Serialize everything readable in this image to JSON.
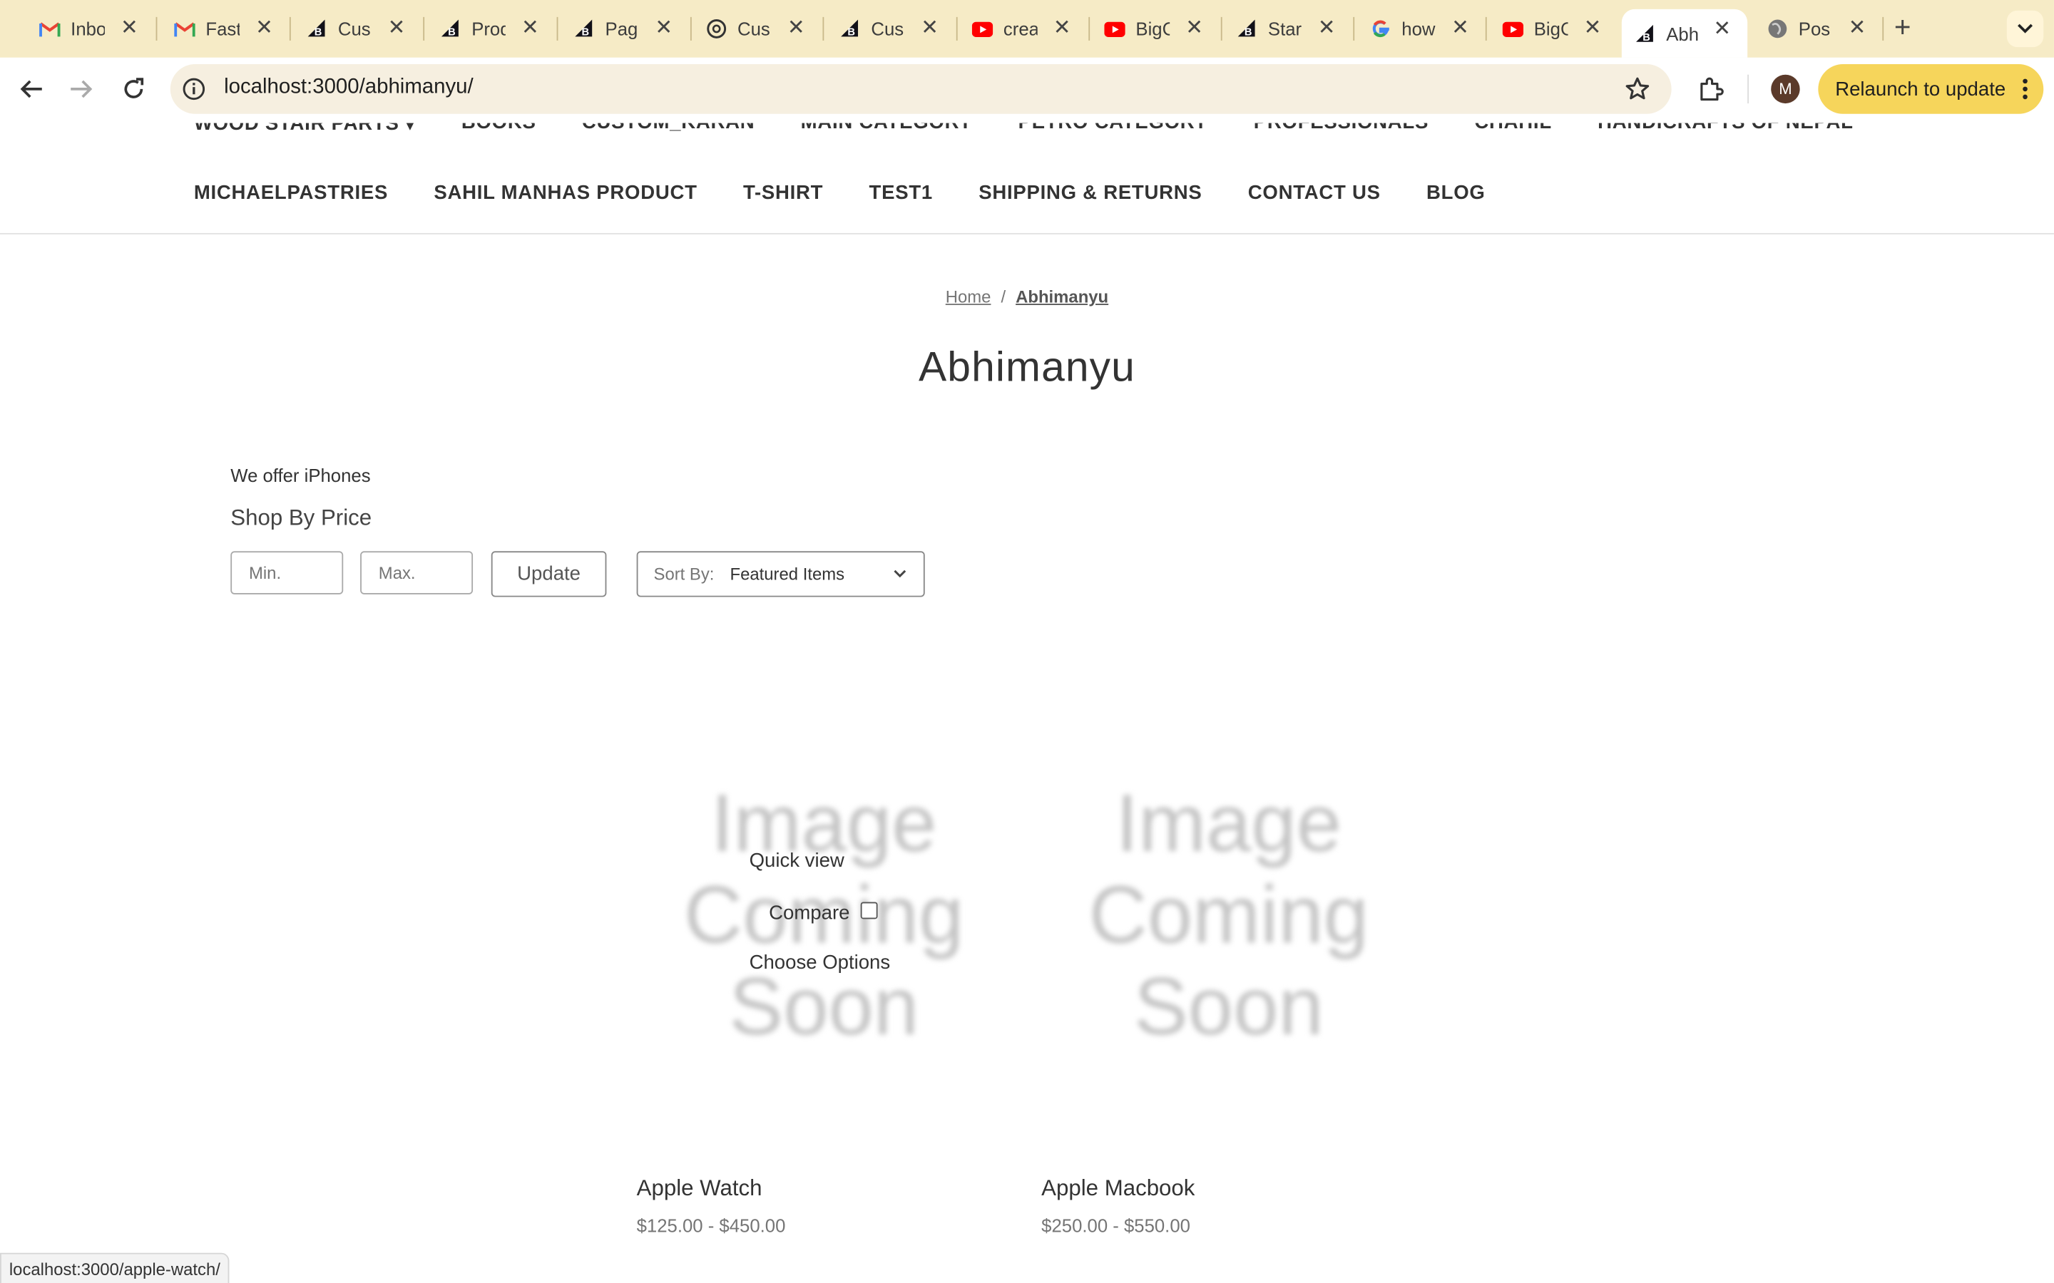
{
  "browser": {
    "tabs": [
      {
        "title": "Inbo",
        "icon": "gmail-icon"
      },
      {
        "title": "Fast",
        "icon": "gmail-icon"
      },
      {
        "title": "Cus",
        "icon": "bigcommerce-icon"
      },
      {
        "title": "Prod",
        "icon": "bigcommerce-icon"
      },
      {
        "title": "Pag",
        "icon": "bigcommerce-icon"
      },
      {
        "title": "Cus",
        "icon": "chatgpt-icon"
      },
      {
        "title": "Cus",
        "icon": "bigcommerce-icon"
      },
      {
        "title": "crea",
        "icon": "youtube-icon"
      },
      {
        "title": "BigC",
        "icon": "youtube-icon"
      },
      {
        "title": "Star",
        "icon": "bigcommerce-icon"
      },
      {
        "title": "how",
        "icon": "google-icon"
      },
      {
        "title": "BigC",
        "icon": "youtube-icon"
      },
      {
        "title": "Abh",
        "icon": "bigcommerce-icon",
        "active": true
      },
      {
        "title": "Pos",
        "icon": "globe-icon"
      }
    ],
    "url": "localhost:3000/abhimanyu/",
    "relaunch_label": "Relaunch to update",
    "avatar_initial": "M",
    "status_url": "localhost:3000/apple-watch/"
  },
  "site_nav": {
    "row1": [
      "WOOD STAIR PARTS",
      "BOOKS",
      "CUSTOM_KARAN",
      "MAIN CATEGORY",
      "PETRO CATEGORY",
      "PROFESSIONALS",
      "CHAHIL",
      "HANDICRAFTS OF NEPAL"
    ],
    "row2": [
      "MICHAELPASTRIES",
      "SAHIL MANHAS PRODUCT",
      "T-SHIRT",
      "TEST1",
      "SHIPPING & RETURNS",
      "CONTACT US",
      "BLOG"
    ]
  },
  "breadcrumb": {
    "home": "Home",
    "separator": "/",
    "current": "Abhimanyu"
  },
  "page": {
    "title": "Abhimanyu",
    "description": "We offer iPhones",
    "shop_by_price": "Shop By Price",
    "min_placeholder": "Min.",
    "max_placeholder": "Max.",
    "update_label": "Update",
    "sort_label": "Sort By:",
    "sort_value": "Featured Items"
  },
  "products": [
    {
      "name": "Apple Watch",
      "price": "$125.00 - $450.00",
      "image_text": [
        "Image",
        "Coming",
        "Soon"
      ]
    },
    {
      "name": "Apple Macbook",
      "price": "$250.00 - $550.00",
      "image_text": [
        "Image",
        "Coming",
        "Soon"
      ]
    }
  ],
  "card_overlay": {
    "quick_view": "Quick view",
    "compare": "Compare",
    "choose_options": "Choose Options"
  },
  "colors": {
    "tabstrip": "#f6ebc6",
    "relaunch": "#f6d55b",
    "omnibox": "#f6efe0"
  }
}
